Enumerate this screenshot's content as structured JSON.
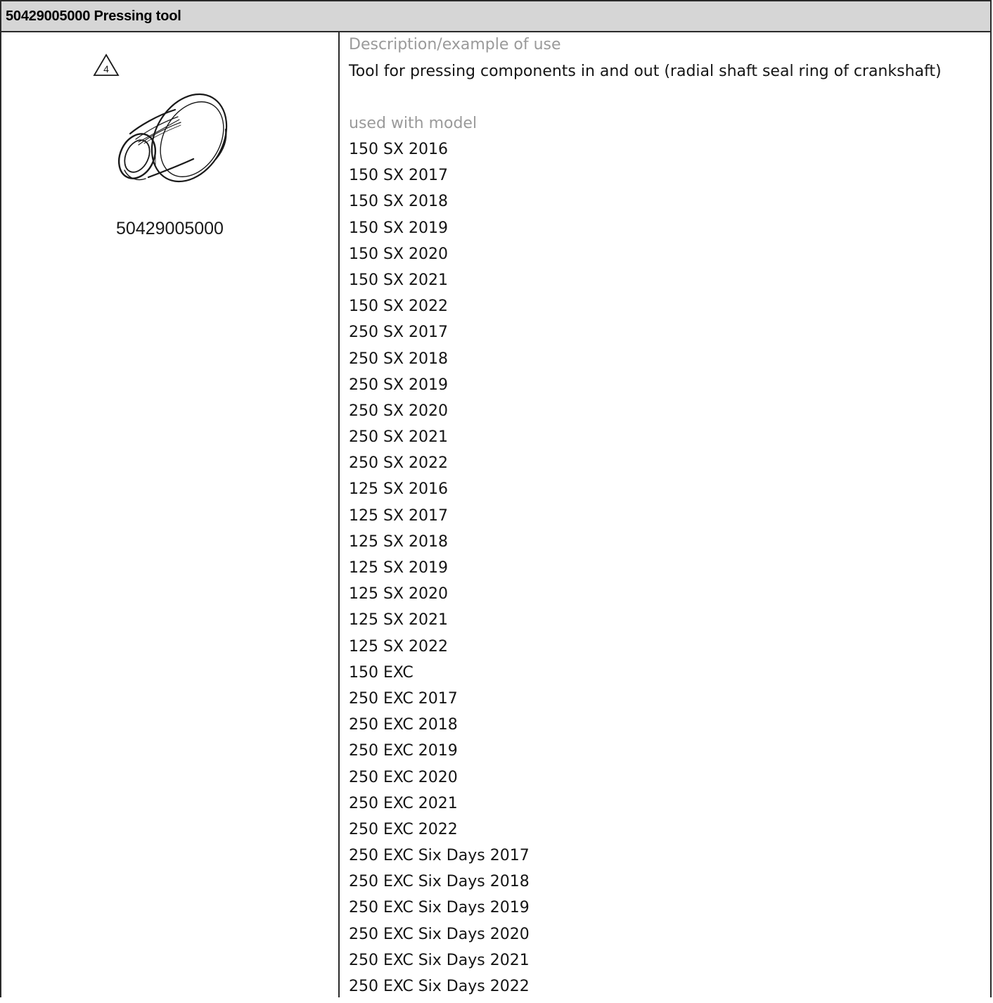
{
  "header": {
    "title": "50429005000 Pressing tool"
  },
  "left": {
    "warning_icon": "warning-triangle-4-icon",
    "warning_number": "4",
    "illustration": "pressing-tool-illustration",
    "part_number": "50429005000"
  },
  "right": {
    "description_label": "Description/example of use",
    "description_text": "Tool for pressing components in and out (radial shaft seal ring of crankshaft)",
    "models_label": "used with model",
    "models": [
      "150 SX 2016",
      "150 SX 2017",
      "150 SX 2018",
      "150 SX 2019",
      "150 SX 2020",
      "150 SX 2021",
      "150 SX 2022",
      "250 SX 2017",
      "250 SX 2018",
      "250 SX 2019",
      "250 SX 2020",
      "250 SX 2021",
      "250 SX 2022",
      "125 SX 2016",
      "125 SX 2017",
      "125 SX 2018",
      "125 SX 2019",
      "125 SX 2020",
      "125 SX 2021",
      "125 SX 2022",
      "150 EXC",
      "250 EXC 2017",
      "250 EXC 2018",
      "250 EXC 2019",
      "250 EXC 2020",
      "250 EXC 2021",
      "250 EXC 2022",
      "250 EXC Six Days 2017",
      "250 EXC Six Days 2018",
      "250 EXC Six Days 2019",
      "250 EXC Six Days 2020",
      "250 EXC Six Days 2021",
      "250 EXC Six Days 2022"
    ]
  }
}
